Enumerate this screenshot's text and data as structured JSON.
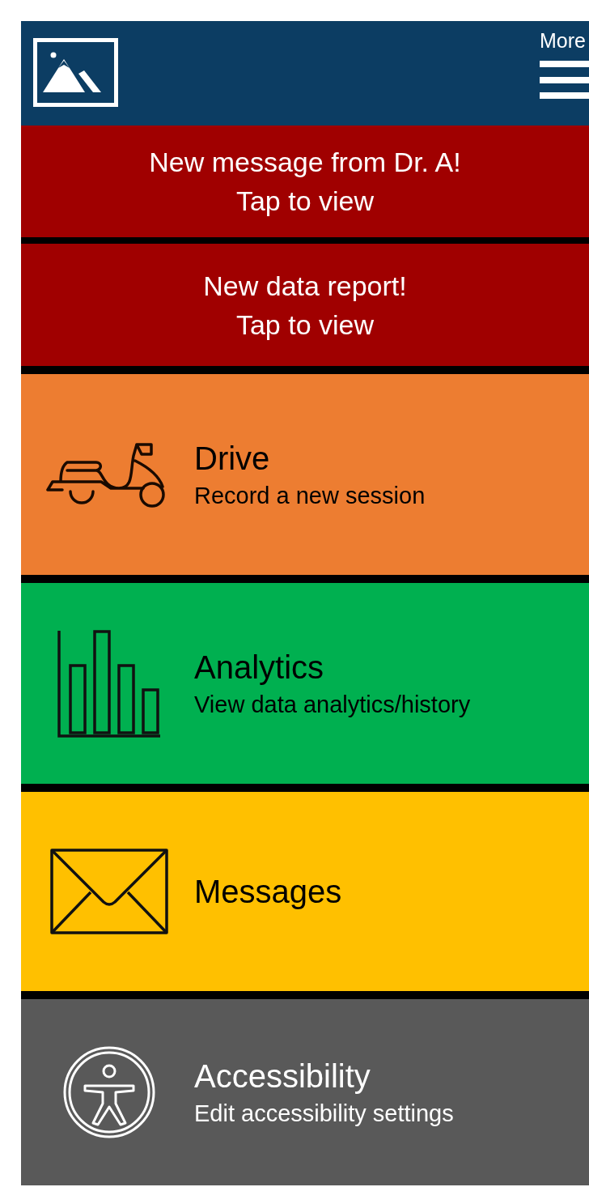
{
  "header": {
    "menu_label": "More"
  },
  "notifications": [
    {
      "title": "New message from Dr. A!",
      "action": "Tap to view"
    },
    {
      "title": "New data report!",
      "action": "Tap to view"
    }
  ],
  "tiles": [
    {
      "kind": "drive",
      "title": "Drive",
      "subtitle": "Record a new session",
      "color": "#ed7d31"
    },
    {
      "kind": "analytics",
      "title": "Analytics",
      "subtitle": "View data analytics/history",
      "color": "#00b050"
    },
    {
      "kind": "messages",
      "title": "Messages",
      "color": "#ffc000"
    },
    {
      "kind": "accessibility",
      "title": "Accessibility",
      "subtitle": "Edit accessibility settings",
      "color": "#595959"
    }
  ]
}
